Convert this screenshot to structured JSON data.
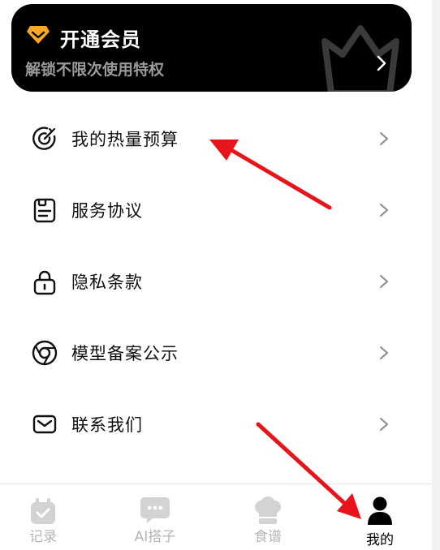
{
  "vip_banner": {
    "title": "开通会员",
    "subtitle": "解锁不限次使用特权",
    "icon": "diamond-icon",
    "chevron": "chevron-right-icon"
  },
  "menu": {
    "items": [
      {
        "label": "我的热量预算",
        "icon": "target-icon"
      },
      {
        "label": "服务协议",
        "icon": "document-icon"
      },
      {
        "label": "隐私条款",
        "icon": "lock-icon"
      },
      {
        "label": "模型备案公示",
        "icon": "aperture-icon"
      },
      {
        "label": "联系我们",
        "icon": "mail-icon"
      }
    ]
  },
  "tabbar": {
    "tabs": [
      {
        "label": "记录",
        "icon": "calendar-check-icon",
        "active": false
      },
      {
        "label": "AI搭子",
        "icon": "chat-bubble-icon",
        "active": false
      },
      {
        "label": "食谱",
        "icon": "chef-hat-icon",
        "active": false
      },
      {
        "label": "我的",
        "icon": "person-icon",
        "active": true
      }
    ]
  },
  "colors": {
    "banner_bg": "#000000",
    "diamond": "#F7A825",
    "annotation_arrow": "#E8141B",
    "inactive_tab": "#B5B5B5",
    "active_tab": "#000000"
  }
}
